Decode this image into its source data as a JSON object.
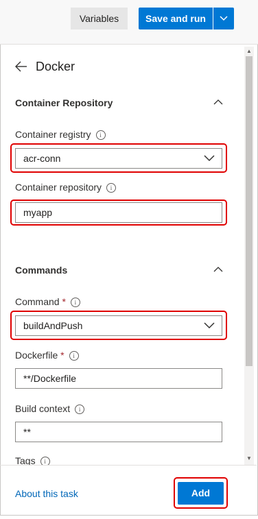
{
  "toolbar": {
    "variables_label": "Variables",
    "save_label": "Save and run"
  },
  "panel": {
    "title": "Docker",
    "sections": {
      "container_repository": {
        "title": "Container Repository",
        "registry_label": "Container registry",
        "registry_value": "acr-conn",
        "repository_label": "Container repository",
        "repository_value": "myapp"
      },
      "commands": {
        "title": "Commands",
        "command_label": "Command",
        "command_value": "buildAndPush",
        "dockerfile_label": "Dockerfile",
        "dockerfile_value": "**/Dockerfile",
        "build_context_label": "Build context",
        "build_context_value": "**",
        "tags_label": "Tags"
      }
    },
    "required_marker": "*",
    "info_glyph": "i"
  },
  "footer": {
    "about_label": "About this task",
    "add_label": "Add"
  },
  "colors": {
    "accent": "#0078d4",
    "highlight": "#e00000",
    "link": "#0067b8"
  }
}
